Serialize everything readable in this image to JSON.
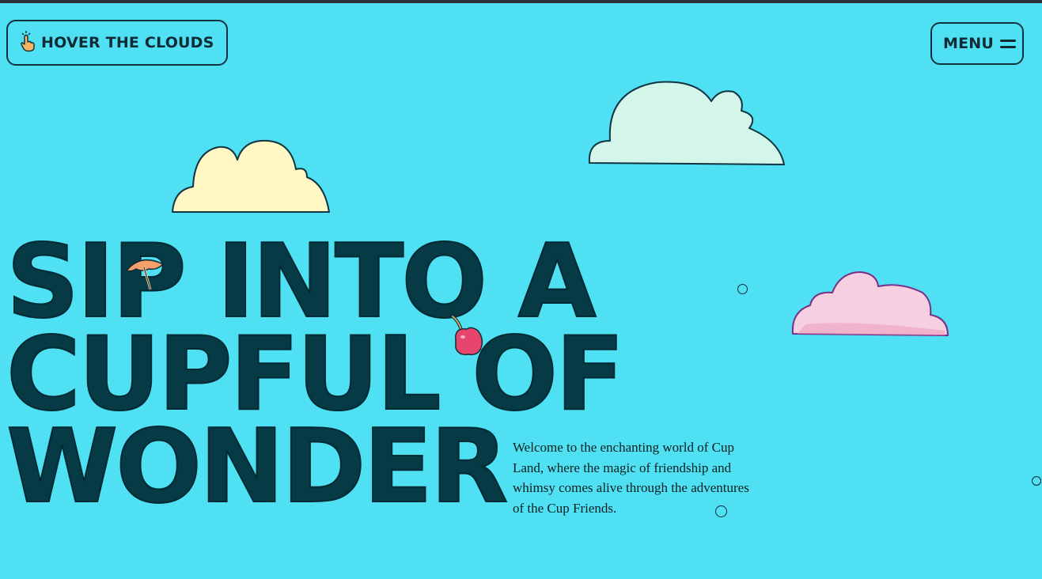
{
  "header": {
    "hover_label": "HOVER THE CLOUDS",
    "menu_label": "MENU"
  },
  "hero": {
    "headline_lines": [
      "SIP INTO A",
      "CUPFUL OF",
      "WONDER"
    ],
    "intro": "Welcome to the enchanting world of Cup Land, where the magic of friendship and whimsy comes alive through the adventures of the Cup Friends."
  },
  "colors": {
    "background": "#4fe0f3",
    "headline": "#063a45",
    "cloud_yellow": "#fff7c4",
    "cloud_mint": "#d3f5ea",
    "cloud_pink": "#f6cfe0",
    "cherry": "#e8456e",
    "umbrella": "#f5a06b"
  },
  "icons": {
    "hover_icon": "pointing-hand-icon",
    "menu_icon": "hamburger-icon"
  }
}
